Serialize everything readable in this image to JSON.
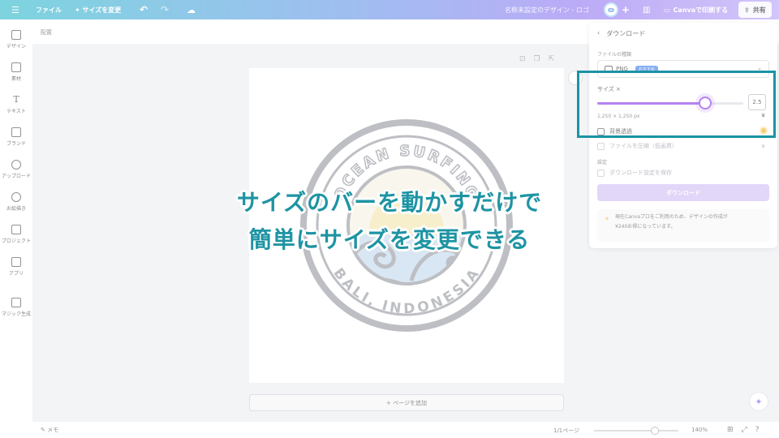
{
  "topbar": {
    "menu_icon": "hamburger-icon",
    "file_label": "ファイル",
    "resize_label": "✦ サイズを変更",
    "doc_title": "名称未設定のデザイン - ロゴ",
    "print_label": "Canvaで印刷する",
    "share_label": "共有"
  },
  "sidebar": {
    "items": [
      {
        "label": "デザイン",
        "icon": "layout-icon"
      },
      {
        "label": "素材",
        "icon": "shapes-icon"
      },
      {
        "label": "テキスト",
        "icon": "text-icon"
      },
      {
        "label": "ブランド",
        "icon": "brand-icon"
      },
      {
        "label": "アップロード",
        "icon": "upload-icon"
      },
      {
        "label": "お絵描き",
        "icon": "draw-icon"
      },
      {
        "label": "プロジェクト",
        "icon": "folder-icon"
      },
      {
        "label": "アプリ",
        "icon": "apps-icon"
      },
      {
        "label": "マジック生成",
        "icon": "magic-icon"
      }
    ]
  },
  "canvas": {
    "subbar_label": "配置",
    "logo": {
      "top_text": "OCEAN SURFING",
      "bottom_text": "BALI, INDONESIA"
    },
    "add_page_label": "+ ページを追加"
  },
  "bottombar": {
    "memo_label": "メモ",
    "pages_label": "1/1ページ",
    "zoom_label": "140%",
    "zoom_fraction": 0.68
  },
  "download_panel": {
    "title": "ダウンロード",
    "file_type_label": "ファイルの種類",
    "file_type_value": "PNG",
    "file_type_badge": "おすすめ",
    "size_label": "サイズ ×",
    "size_value": "2.5",
    "size_fraction": 0.74,
    "dims_label": "1,250 × 1,250 px",
    "transparent_bg_label": "背景透過",
    "compress_label": "ファイルを圧縮（低画質）",
    "settings_label": "設定",
    "save_settings_label": "ダウンロード設定を保存",
    "download_button": "ダウンロード",
    "note_line1": "現在Canvaプロをご利用のため、デザインの作成が",
    "note_line2": "¥240お得になっています。"
  },
  "caption": {
    "line1": "サイズのバーを動かすだけで",
    "line2": "簡単にサイズを変更できる"
  },
  "colors": {
    "accent": "#1e94a3",
    "slider": "#7d2ae8"
  }
}
